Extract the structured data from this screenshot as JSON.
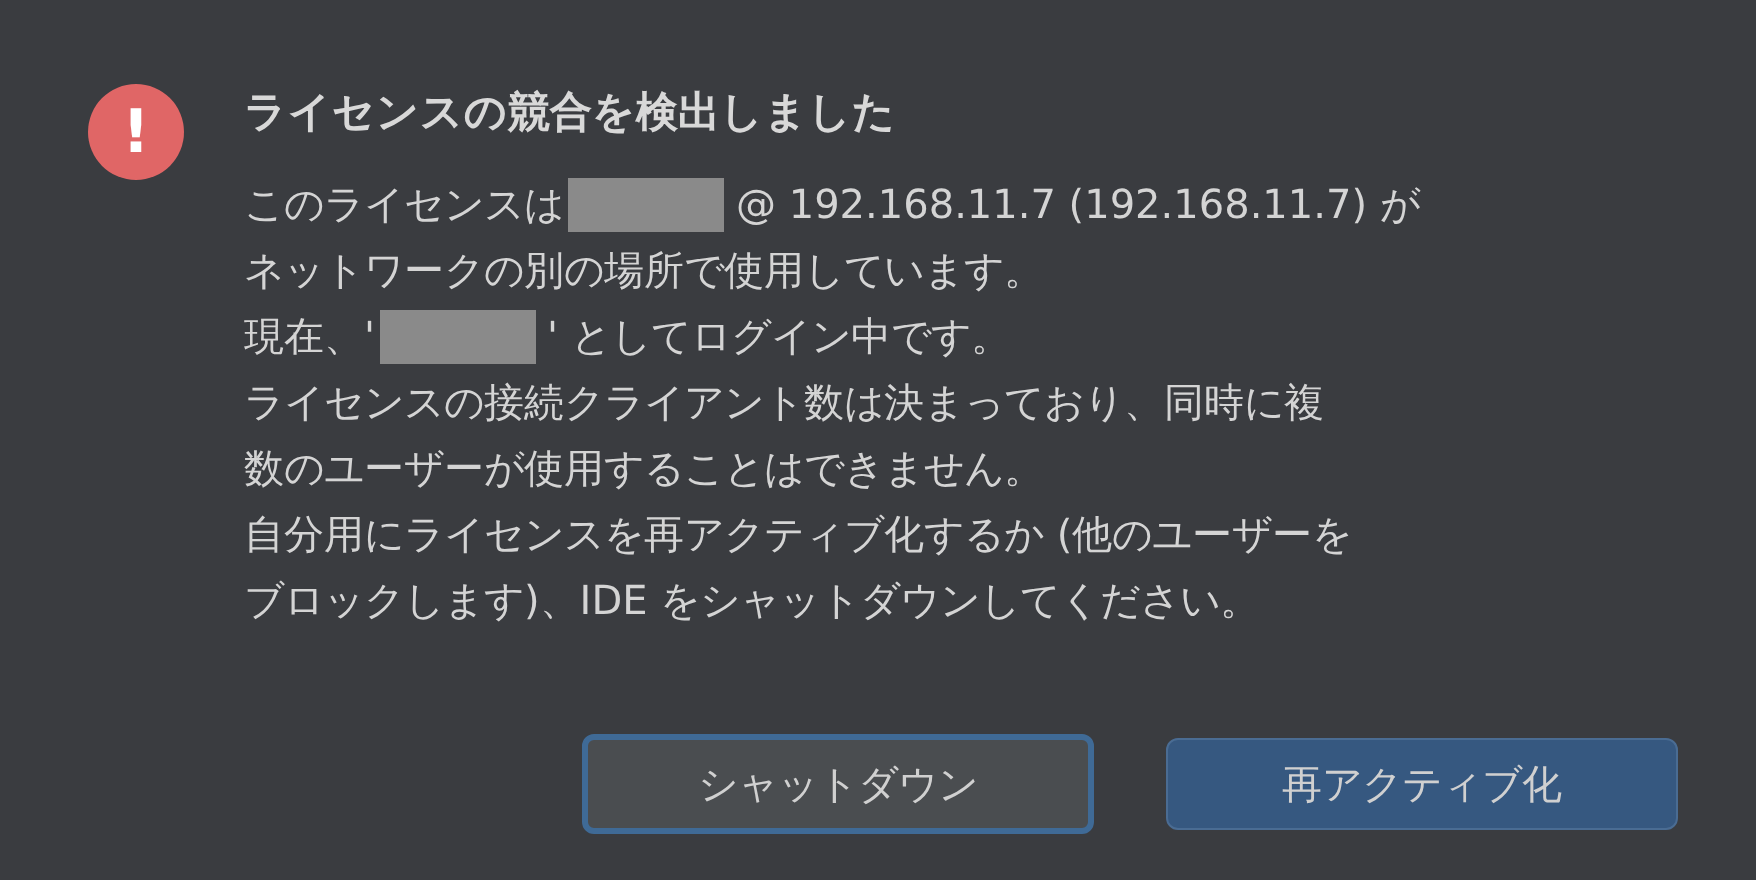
{
  "dialog": {
    "icon": "!",
    "title": "ライセンスの競合を検出しました",
    "lines": [
      {
        "parts": [
          {
            "kind": "text",
            "text": "このライセンスは"
          },
          {
            "kind": "redacted"
          },
          {
            "kind": "text",
            "text": "@ 192.168.11.7 (192.168.11.7) が"
          }
        ]
      },
      {
        "parts": [
          {
            "kind": "text",
            "text": "ネットワークの別の場所で使用しています。"
          }
        ]
      },
      {
        "parts": [
          {
            "kind": "text",
            "text": "現在、'"
          },
          {
            "kind": "redacted"
          },
          {
            "kind": "text",
            "text": "' としてログイン中です。"
          }
        ]
      },
      {
        "parts": [
          {
            "kind": "text",
            "text": "ライセンスの接続クライアント数は決まっており、同時に複"
          }
        ]
      },
      {
        "parts": [
          {
            "kind": "text",
            "text": "数のユーザーが使用することはできません。"
          }
        ]
      },
      {
        "parts": [
          {
            "kind": "text",
            "text": "自分用にライセンスを再アクティブ化するか (他のユーザーを"
          }
        ]
      },
      {
        "parts": [
          {
            "kind": "text",
            "text": "ブロックします)、IDE をシャットダウンしてください。"
          }
        ]
      }
    ],
    "buttons": [
      {
        "label": "シャットダウン",
        "kind": "secondary",
        "focused": true
      },
      {
        "label": "再アクティブ化",
        "kind": "primary",
        "focused": false
      }
    ]
  }
}
